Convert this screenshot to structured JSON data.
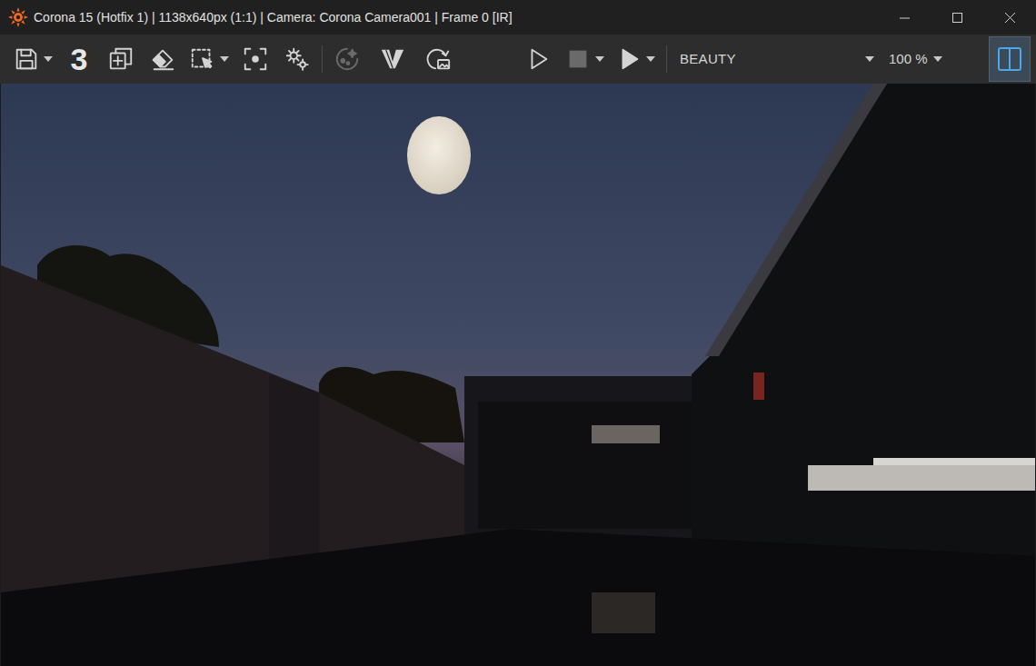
{
  "window": {
    "title": "Corona 15 (Hotfix 1) | 1138x640px (1:1) | Camera: Corona Camera001 | Frame 0 [IR]"
  },
  "toolbar": {
    "tools": [
      {
        "kind": "split",
        "disabled": false
      },
      {
        "kind": "text",
        "label": "3",
        "disabled": false
      },
      {
        "kind": "button",
        "disabled": false
      },
      {
        "kind": "button",
        "disabled": false
      },
      {
        "kind": "split",
        "disabled": false
      },
      {
        "kind": "button",
        "disabled": false
      },
      {
        "kind": "button",
        "disabled": false
      }
    ],
    "render_tools": [
      {
        "kind": "button",
        "disabled": true
      },
      {
        "kind": "button",
        "disabled": false
      },
      {
        "kind": "button",
        "disabled": false
      }
    ],
    "render_controls": [
      {
        "kind": "button",
        "disabled": false
      },
      {
        "kind": "split",
        "disabled": true
      },
      {
        "kind": "split",
        "disabled": false
      }
    ],
    "pass": "BEAUTY",
    "zoom": "100 %",
    "split_view": {
      "selected": true
    }
  }
}
